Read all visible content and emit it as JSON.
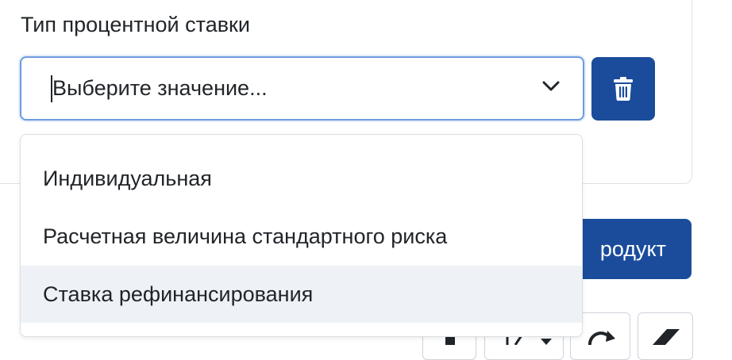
{
  "field": {
    "label": "Тип процентной ставки",
    "placeholder": "Выберите значение..."
  },
  "dropdown": {
    "options": [
      {
        "label": "Индивидуальная"
      },
      {
        "label": "Расчетная величина стандартного риска"
      },
      {
        "label": "Ставка рефинансирования"
      }
    ],
    "highlighted_index": 2
  },
  "product_button": {
    "label": "родукт"
  },
  "icons": {
    "chevron": "chevron-down-icon",
    "delete": "trash-icon",
    "refresh": "refresh-icon",
    "eraser": "eraser-icon"
  },
  "colors": {
    "primary": "#1b4c9b",
    "focus_border": "#6d9be0",
    "highlight": "#eef2f6"
  }
}
